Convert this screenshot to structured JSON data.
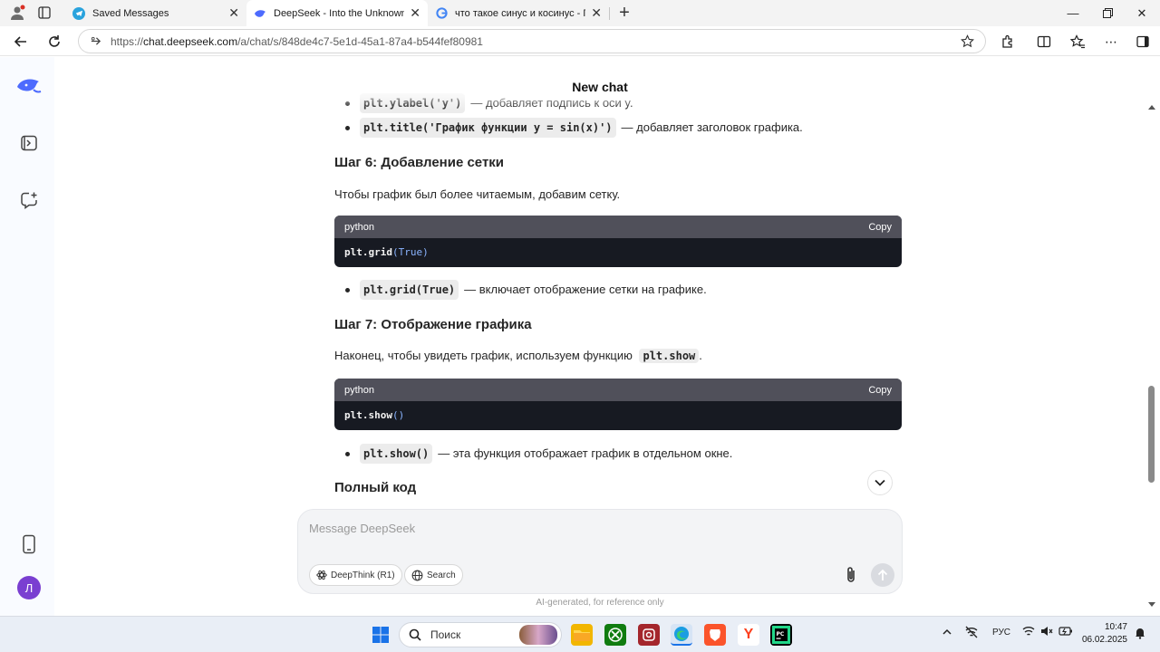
{
  "browser": {
    "tabs": [
      {
        "title": "Saved Messages",
        "active": false
      },
      {
        "title": "DeepSeek - Into the Unknown",
        "active": true
      },
      {
        "title": "что такое синус и косинус - Пои",
        "active": false
      }
    ],
    "url_prefix": "https://",
    "url_host": "chat.deepseek.com",
    "url_path": "/a/chat/s/848de4c7-5e1d-45a1-87a4-b544fef80981"
  },
  "page": {
    "title": "New chat"
  },
  "content": {
    "partial_bullet_code": "plt.ylabel('y')",
    "partial_bullet_text": "— добавляет подпись к оси y.",
    "bullet_title_code": "plt.title('График функции y = sin(x)')",
    "bullet_title_text": "— добавляет заголовок графика.",
    "step6_heading": "Шаг 6: Добавление сетки",
    "step6_text": "Чтобы график был более читаемым, добавим сетку.",
    "code1_lang": "python",
    "code1_copy": "Copy",
    "code1_fn": "plt.grid",
    "code1_args": "(True)",
    "bullet_grid_code": "plt.grid(True)",
    "bullet_grid_text": "— включает отображение сетки на графике.",
    "step7_heading": "Шаг 7: Отображение графика",
    "step7_text": "Наконец, чтобы увидеть график, используем функцию",
    "step7_code": "plt.show",
    "step7_end": ".",
    "code2_lang": "python",
    "code2_copy": "Copy",
    "code2_fn": "plt.show",
    "code2_args": "()",
    "bullet_show_code": "plt.show()",
    "bullet_show_text": "— эта функция отображает график в отдельном окне.",
    "full_code_heading": "Полный код"
  },
  "composer": {
    "placeholder": "Message DeepSeek",
    "deepthink_label": "DeepThink (R1)",
    "search_label": "Search",
    "disclaimer": "AI-generated, for reference only"
  },
  "sidebar": {
    "avatar_letter": "Л"
  },
  "taskbar": {
    "search_placeholder": "Поиск",
    "language": "РУС",
    "time": "10:47",
    "date": "06.02.2025"
  },
  "colors": {
    "accent": "#4d6bfe",
    "avatar": "#7a3fd1",
    "code_bg": "#171a22",
    "code_header": "#50505a"
  }
}
